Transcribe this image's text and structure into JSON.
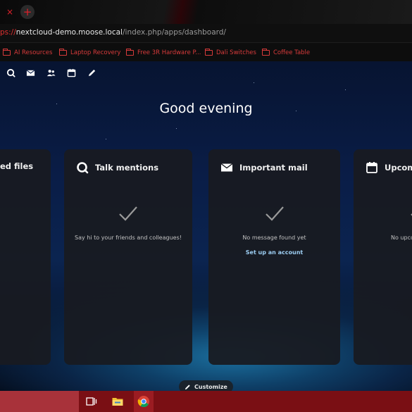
{
  "browser": {
    "tab_close_glyph": "×",
    "new_tab_glyph": "+",
    "url": {
      "scheme": "ps://",
      "host": "nextcloud-demo.moose.local",
      "path": "/index.php/apps/dashboard/"
    },
    "bookmarks": [
      "AI Resources",
      "Laptop Recovery",
      "Free 3R Hardware P...",
      "Dali Switches",
      "Coffee Table"
    ],
    "accent_color": "#e0202a"
  },
  "nextcloud": {
    "app_nav_icons": [
      "talk-icon",
      "mail-icon",
      "contacts-icon",
      "calendar-icon",
      "notes-icon"
    ],
    "greeting": "Good evening",
    "panels": [
      {
        "title": "ed files",
        "icon": "none"
      },
      {
        "title": "Talk mentions",
        "icon": "talk-icon",
        "empty_text": "Say hi to your friends and colleagues!"
      },
      {
        "title": "Important mail",
        "icon": "mail-icon",
        "empty_text": "No message found yet",
        "link": "Set up an account"
      },
      {
        "title": "Upcom",
        "icon": "calendar-icon",
        "empty_text": "No upco"
      }
    ],
    "customize_label": "Customize",
    "link_color": "#9ccdf2"
  },
  "taskbar": {
    "color": "#7a0f14",
    "icons": [
      "task-view-icon",
      "file-explorer-icon",
      "chrome-icon"
    ]
  }
}
